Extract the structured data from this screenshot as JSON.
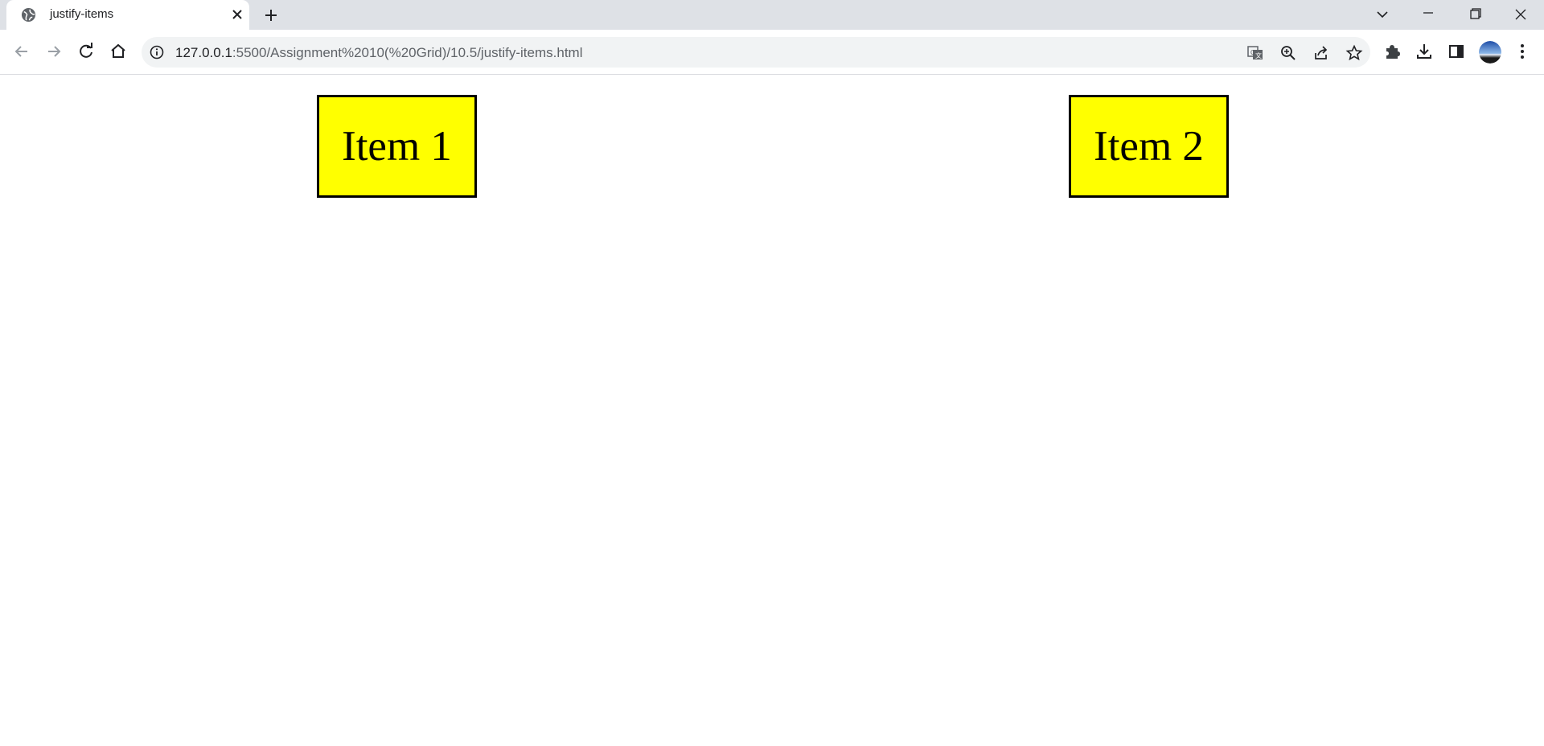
{
  "browser": {
    "tab": {
      "title": "justify-items"
    },
    "address": {
      "host": "127.0.0.1",
      "path": ":5500/Assignment%2010(%20Grid)/10.5/justify-items.html"
    },
    "icons": {
      "favicon": "globe-icon",
      "tab_close": "close-icon",
      "new_tab": "plus-icon",
      "tab_search": "chevron-down-icon",
      "minimize": "minimize-icon",
      "restore": "restore-icon",
      "window_close": "close-icon",
      "back": "back-arrow-icon",
      "forward": "forward-arrow-icon",
      "reload": "reload-icon",
      "home": "home-icon",
      "site_info": "info-icon",
      "translate": "translate-icon",
      "zoom": "zoom-icon",
      "share": "share-icon",
      "bookmark": "star-icon",
      "extensions": "puzzle-icon",
      "downloads": "download-icon",
      "side_panel": "side-panel-icon",
      "menu": "kebab-menu-icon"
    }
  },
  "page": {
    "items": [
      {
        "label": "Item 1"
      },
      {
        "label": "Item 2"
      }
    ],
    "item_color": "#ffff00",
    "item_border_color": "#000000"
  }
}
